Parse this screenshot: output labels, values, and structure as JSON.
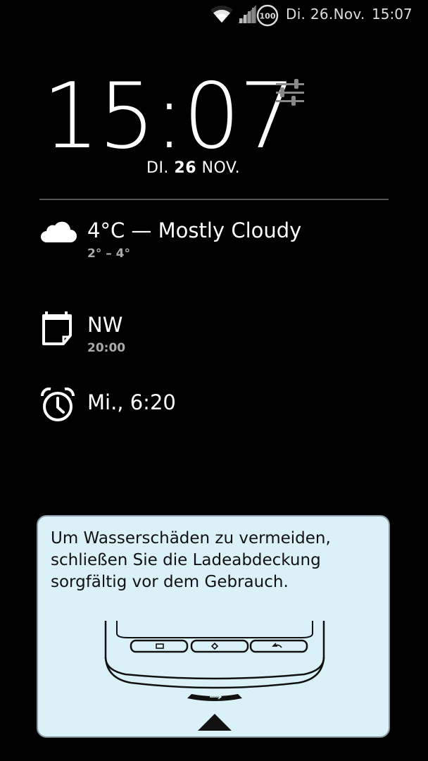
{
  "status_bar": {
    "battery_level": "100",
    "date": "Di. 26.Nov.",
    "time": "15:07",
    "icons": [
      "wifi-icon",
      "signal-icon",
      "battery-icon"
    ]
  },
  "lockscreen": {
    "clock": "15:07",
    "date_day": "DI.",
    "date_num": "26",
    "date_month": "NOV."
  },
  "weather": {
    "summary": "4°C — Mostly Cloudy",
    "range": "2° – 4°",
    "icon": "cloud-icon"
  },
  "calendar": {
    "title": "NW",
    "time": "20:00",
    "icon": "calendar-icon"
  },
  "alarm": {
    "time": "Mi., 6:20",
    "icon": "alarm-clock-icon"
  },
  "notice": {
    "text": "Um Wasserschäden zu vermeiden, schließen Sie die Ladeabdeckung sorgfältig vor dem Gebrauch."
  },
  "colors": {
    "background": "#000000",
    "notice_bg": "#daf1f8",
    "divider": "#555555"
  }
}
